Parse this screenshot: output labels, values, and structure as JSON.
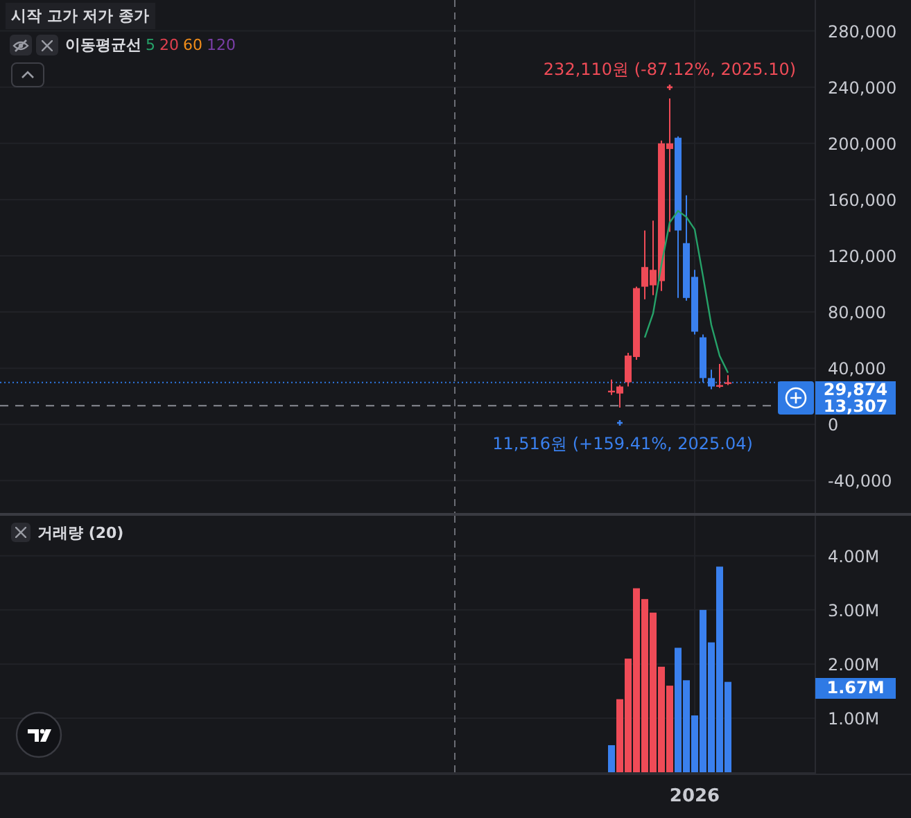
{
  "legend": {
    "ohlc_label": "시작 고가 저가 종가"
  },
  "indicator": {
    "name": "이동평균선",
    "visible": false,
    "periods": [
      {
        "label": "5",
        "color": "#26a269"
      },
      {
        "label": "20",
        "color": "#e0404e"
      },
      {
        "label": "60",
        "color": "#f08c1a"
      },
      {
        "label": "120",
        "color": "#7b3fa8"
      }
    ]
  },
  "price_chart": {
    "chart_data": {
      "type": "candlestick",
      "grid": true,
      "categories": [
        null,
        null,
        null,
        null,
        null,
        null,
        null,
        null,
        null,
        null,
        null,
        null,
        null,
        null,
        null,
        null,
        null,
        null,
        null,
        null,
        null,
        null,
        null,
        null,
        null,
        null,
        null,
        null,
        null,
        null,
        null,
        null,
        null,
        null,
        null,
        null,
        null,
        null,
        null,
        null,
        null,
        null,
        null,
        null,
        null,
        null,
        null,
        null,
        null,
        null,
        null,
        null,
        null,
        null,
        null,
        null,
        null,
        null,
        null,
        null,
        null,
        null,
        null,
        null,
        null,
        null,
        null,
        null,
        null,
        null,
        null,
        null,
        null,
        null,
        null,
        null,
        null,
        null,
        null,
        null,
        null,
        null,
        null,
        null,
        null,
        null,
        null,
        null,
        null,
        null,
        null,
        null,
        null,
        null,
        null,
        null,
        null,
        null
      ],
      "ylim": [
        -63000,
        302000
      ],
      "yticks": [
        {
          "value": 280000,
          "label": "280,000"
        },
        {
          "value": 240000,
          "label": "240,000"
        },
        {
          "value": 200000,
          "label": "200,000"
        },
        {
          "value": 160000,
          "label": "160,000"
        },
        {
          "value": 120000,
          "label": "120,000"
        },
        {
          "value": 80000,
          "label": "80,000"
        },
        {
          "value": 40000,
          "label": "40,000"
        },
        {
          "value": 0,
          "label": "0"
        },
        {
          "value": -40000,
          "label": "-40,000"
        }
      ],
      "ohlc": [
        null,
        null,
        null,
        null,
        null,
        null,
        null,
        null,
        null,
        null,
        null,
        null,
        null,
        null,
        null,
        null,
        null,
        null,
        null,
        null,
        null,
        null,
        null,
        null,
        null,
        null,
        null,
        null,
        null,
        null,
        null,
        null,
        null,
        null,
        null,
        null,
        null,
        null,
        null,
        null,
        null,
        null,
        null,
        null,
        null,
        null,
        null,
        null,
        null,
        null,
        null,
        null,
        null,
        null,
        null,
        null,
        null,
        null,
        null,
        null,
        null,
        null,
        null,
        null,
        null,
        null,
        null,
        null,
        null,
        null,
        null,
        null,
        null,
        [
          24000,
          32000,
          21000,
          24000
        ],
        [
          22000,
          28000,
          12000,
          27000
        ],
        [
          30000,
          51000,
          27000,
          49000
        ],
        [
          48000,
          98000,
          46000,
          97000
        ],
        [
          98000,
          138000,
          89000,
          112000
        ],
        [
          99000,
          145000,
          92000,
          110000
        ],
        [
          102000,
          202000,
          95000,
          200000
        ],
        [
          196000,
          232000,
          137000,
          200000
        ],
        [
          204000,
          205000,
          90000,
          138000
        ],
        [
          129000,
          163000,
          88000,
          90000
        ],
        [
          105000,
          110000,
          64000,
          66000
        ],
        [
          62000,
          64000,
          30000,
          33000
        ],
        [
          33000,
          39000,
          25000,
          27000
        ],
        [
          28000,
          43000,
          26000,
          28000
        ],
        [
          30000,
          35000,
          28000,
          30000
        ],
        null,
        null,
        null,
        null,
        null,
        null,
        null,
        null,
        null,
        null
      ],
      "ref_lines": [
        {
          "axis": "y",
          "value": 29874,
          "label": "29,874"
        },
        {
          "axis": "y",
          "value": 13307,
          "label": "13,307"
        }
      ],
      "annotations": [
        {
          "text": "232,110원 (-87.12%, 2025.10)"
        },
        {
          "text": "11,516원 (+159.41%, 2025.04)"
        }
      ]
    }
  },
  "volume_chart": {
    "title": "거래량 (20)",
    "current_volume": "1.67M",
    "chart_data": {
      "type": "bar",
      "stacked": true,
      "grid": true,
      "categories": [
        null,
        null,
        null,
        null,
        null,
        null,
        null,
        null,
        null,
        null,
        null,
        null,
        null,
        null,
        null,
        null,
        null,
        null,
        null,
        null,
        null,
        null,
        null,
        null,
        null,
        null,
        null,
        null,
        null,
        null,
        null,
        null,
        null,
        null,
        null,
        null,
        null,
        null,
        null,
        null,
        null,
        null,
        null,
        null,
        null,
        null,
        null,
        null,
        null,
        null,
        null,
        null,
        null,
        null,
        null,
        null,
        null,
        null,
        null,
        null,
        null,
        null,
        null,
        null,
        null,
        null,
        null,
        null,
        null,
        null,
        null,
        null,
        null,
        null,
        null,
        null,
        null,
        null,
        null,
        null,
        null,
        null,
        null,
        null,
        null,
        null,
        null,
        null,
        null,
        null,
        null,
        null,
        null,
        null,
        null,
        null,
        null,
        null
      ],
      "ylim": [
        0,
        4.74
      ],
      "yticks": [
        {
          "value": 4,
          "label": "4.00M"
        },
        {
          "value": 3,
          "label": "3.00M"
        },
        {
          "value": 2,
          "label": "2.00M"
        },
        {
          "value": 1,
          "label": "1.00M"
        }
      ],
      "annotations": [
        {
          "text": "2026"
        }
      ],
      "series": [
        {
          "color": "#3a80ee",
          "values": [
            null,
            null,
            null,
            null,
            null,
            null,
            null,
            null,
            null,
            null,
            null,
            null,
            null,
            null,
            null,
            null,
            null,
            null,
            null,
            null,
            null,
            null,
            null,
            null,
            null,
            null,
            null,
            null,
            null,
            null,
            null,
            null,
            null,
            null,
            null,
            null,
            null,
            null,
            null,
            null,
            null,
            null,
            null,
            null,
            null,
            null,
            null,
            null,
            null,
            null,
            null,
            null,
            null,
            null,
            null,
            null,
            null,
            null,
            null,
            null,
            null,
            null,
            null,
            null,
            null,
            null,
            null,
            null,
            null,
            null,
            null,
            null,
            null,
            0.5,
            null,
            null,
            null,
            null,
            null,
            null,
            null,
            2.3,
            1.7,
            1.05,
            3.0,
            2.4,
            3.8,
            1.67,
            null,
            null,
            null,
            null,
            null,
            null,
            null,
            null,
            null,
            null
          ]
        },
        {
          "color": "#ef4b57",
          "values": [
            null,
            null,
            null,
            null,
            null,
            null,
            null,
            null,
            null,
            null,
            null,
            null,
            null,
            null,
            null,
            null,
            null,
            null,
            null,
            null,
            null,
            null,
            null,
            null,
            null,
            null,
            null,
            null,
            null,
            null,
            null,
            null,
            null,
            null,
            null,
            null,
            null,
            null,
            null,
            null,
            null,
            null,
            null,
            null,
            null,
            null,
            null,
            null,
            null,
            null,
            null,
            null,
            null,
            null,
            null,
            null,
            null,
            null,
            null,
            null,
            null,
            null,
            null,
            null,
            null,
            null,
            null,
            null,
            null,
            null,
            null,
            null,
            null,
            null,
            1.35,
            2.1,
            3.4,
            3.2,
            2.95,
            1.95,
            1.6,
            null,
            null,
            null,
            null,
            null,
            null,
            null,
            null,
            null,
            null,
            null,
            null,
            null,
            null,
            null,
            null,
            null
          ]
        }
      ]
    }
  }
}
